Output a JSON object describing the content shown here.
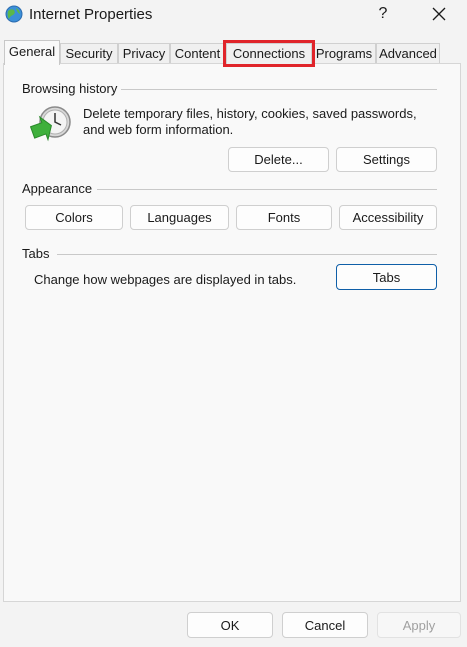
{
  "window": {
    "title": "Internet Properties",
    "help_label": "?"
  },
  "tabs": [
    {
      "label": "General"
    },
    {
      "label": "Security"
    },
    {
      "label": "Privacy"
    },
    {
      "label": "Content"
    },
    {
      "label": "Connections"
    },
    {
      "label": "Programs"
    },
    {
      "label": "Advanced"
    }
  ],
  "browsing_history": {
    "label": "Browsing history",
    "description_line1": "Delete temporary files, history, cookies, saved passwords,",
    "description_line2": "and web form information.",
    "delete_label": "Delete...",
    "settings_label": "Settings"
  },
  "appearance": {
    "label": "Appearance",
    "colors_label": "Colors",
    "languages_label": "Languages",
    "fonts_label": "Fonts",
    "accessibility_label": "Accessibility"
  },
  "tabs_section": {
    "label": "Tabs",
    "description": "Change how webpages are displayed in tabs.",
    "tabs_button_label": "Tabs"
  },
  "footer": {
    "ok_label": "OK",
    "cancel_label": "Cancel",
    "apply_label": "Apply"
  },
  "colors": {
    "highlight": "#e0242a",
    "default_button_border": "#0f5fa8"
  }
}
